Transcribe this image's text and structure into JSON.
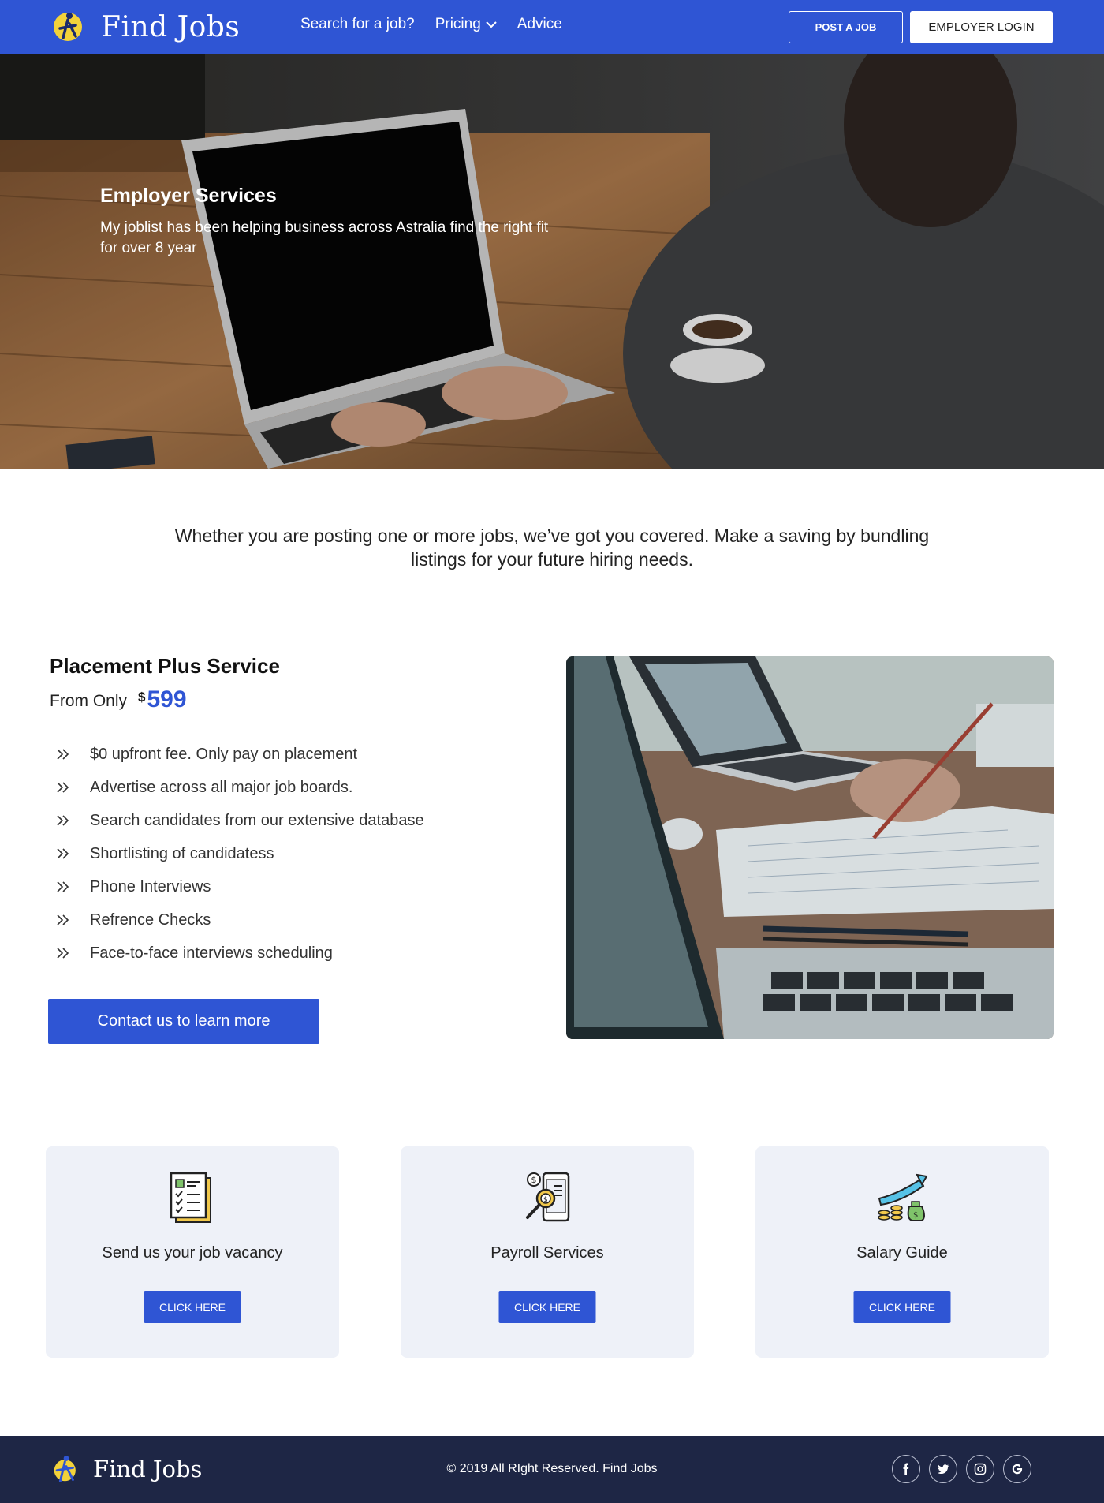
{
  "header": {
    "logo_text": "Find Jobs",
    "nav": [
      {
        "label": "Search for a job?"
      },
      {
        "label": "Pricing"
      },
      {
        "label": "Advice"
      }
    ],
    "post_job_label": "POST A JOB",
    "employer_login_label": "EMPLOYER LOGIN"
  },
  "hero": {
    "title": "Employer Services",
    "subtitle": "My joblist has been helping business across Astralia find the right fit for over 8 year"
  },
  "intro": {
    "text": "Whether you are posting one or more jobs, we’ve got you covered. Make a saving by bundling listings for your future hiring needs."
  },
  "placement": {
    "title": "Placement Plus Service",
    "price_label": "From Only",
    "currency": "$",
    "price": "599",
    "features": [
      "$0 upfront fee. Only pay on placement",
      "Advertise across all major job boards.",
      "Search candidates from our extensive database",
      "Shortlisting of candidatess",
      "Phone Interviews",
      "Refrence Checks",
      "Face-to-face interviews scheduling"
    ],
    "cta_label": "Contact us to learn more"
  },
  "cards": [
    {
      "title": "Send us your job vacancy",
      "button": "CLICK HERE",
      "icon": "checklist-document-icon"
    },
    {
      "title": "Payroll Services",
      "button": "CLICK HERE",
      "icon": "payroll-phone-icon"
    },
    {
      "title": "Salary Guide",
      "button": "CLICK HERE",
      "icon": "salary-growth-icon"
    }
  ],
  "footer": {
    "logo_text": "Find Jobs",
    "copyright": "© 2019 All RIght Reserved. Find Jobs",
    "socials": [
      "facebook-icon",
      "twitter-icon",
      "instagram-icon",
      "google-icon"
    ]
  },
  "colors": {
    "brand_blue": "#2f55d4",
    "footer_navy": "#1e2645",
    "card_bg": "#eef1f8",
    "logo_yellow": "#f3d23a"
  }
}
